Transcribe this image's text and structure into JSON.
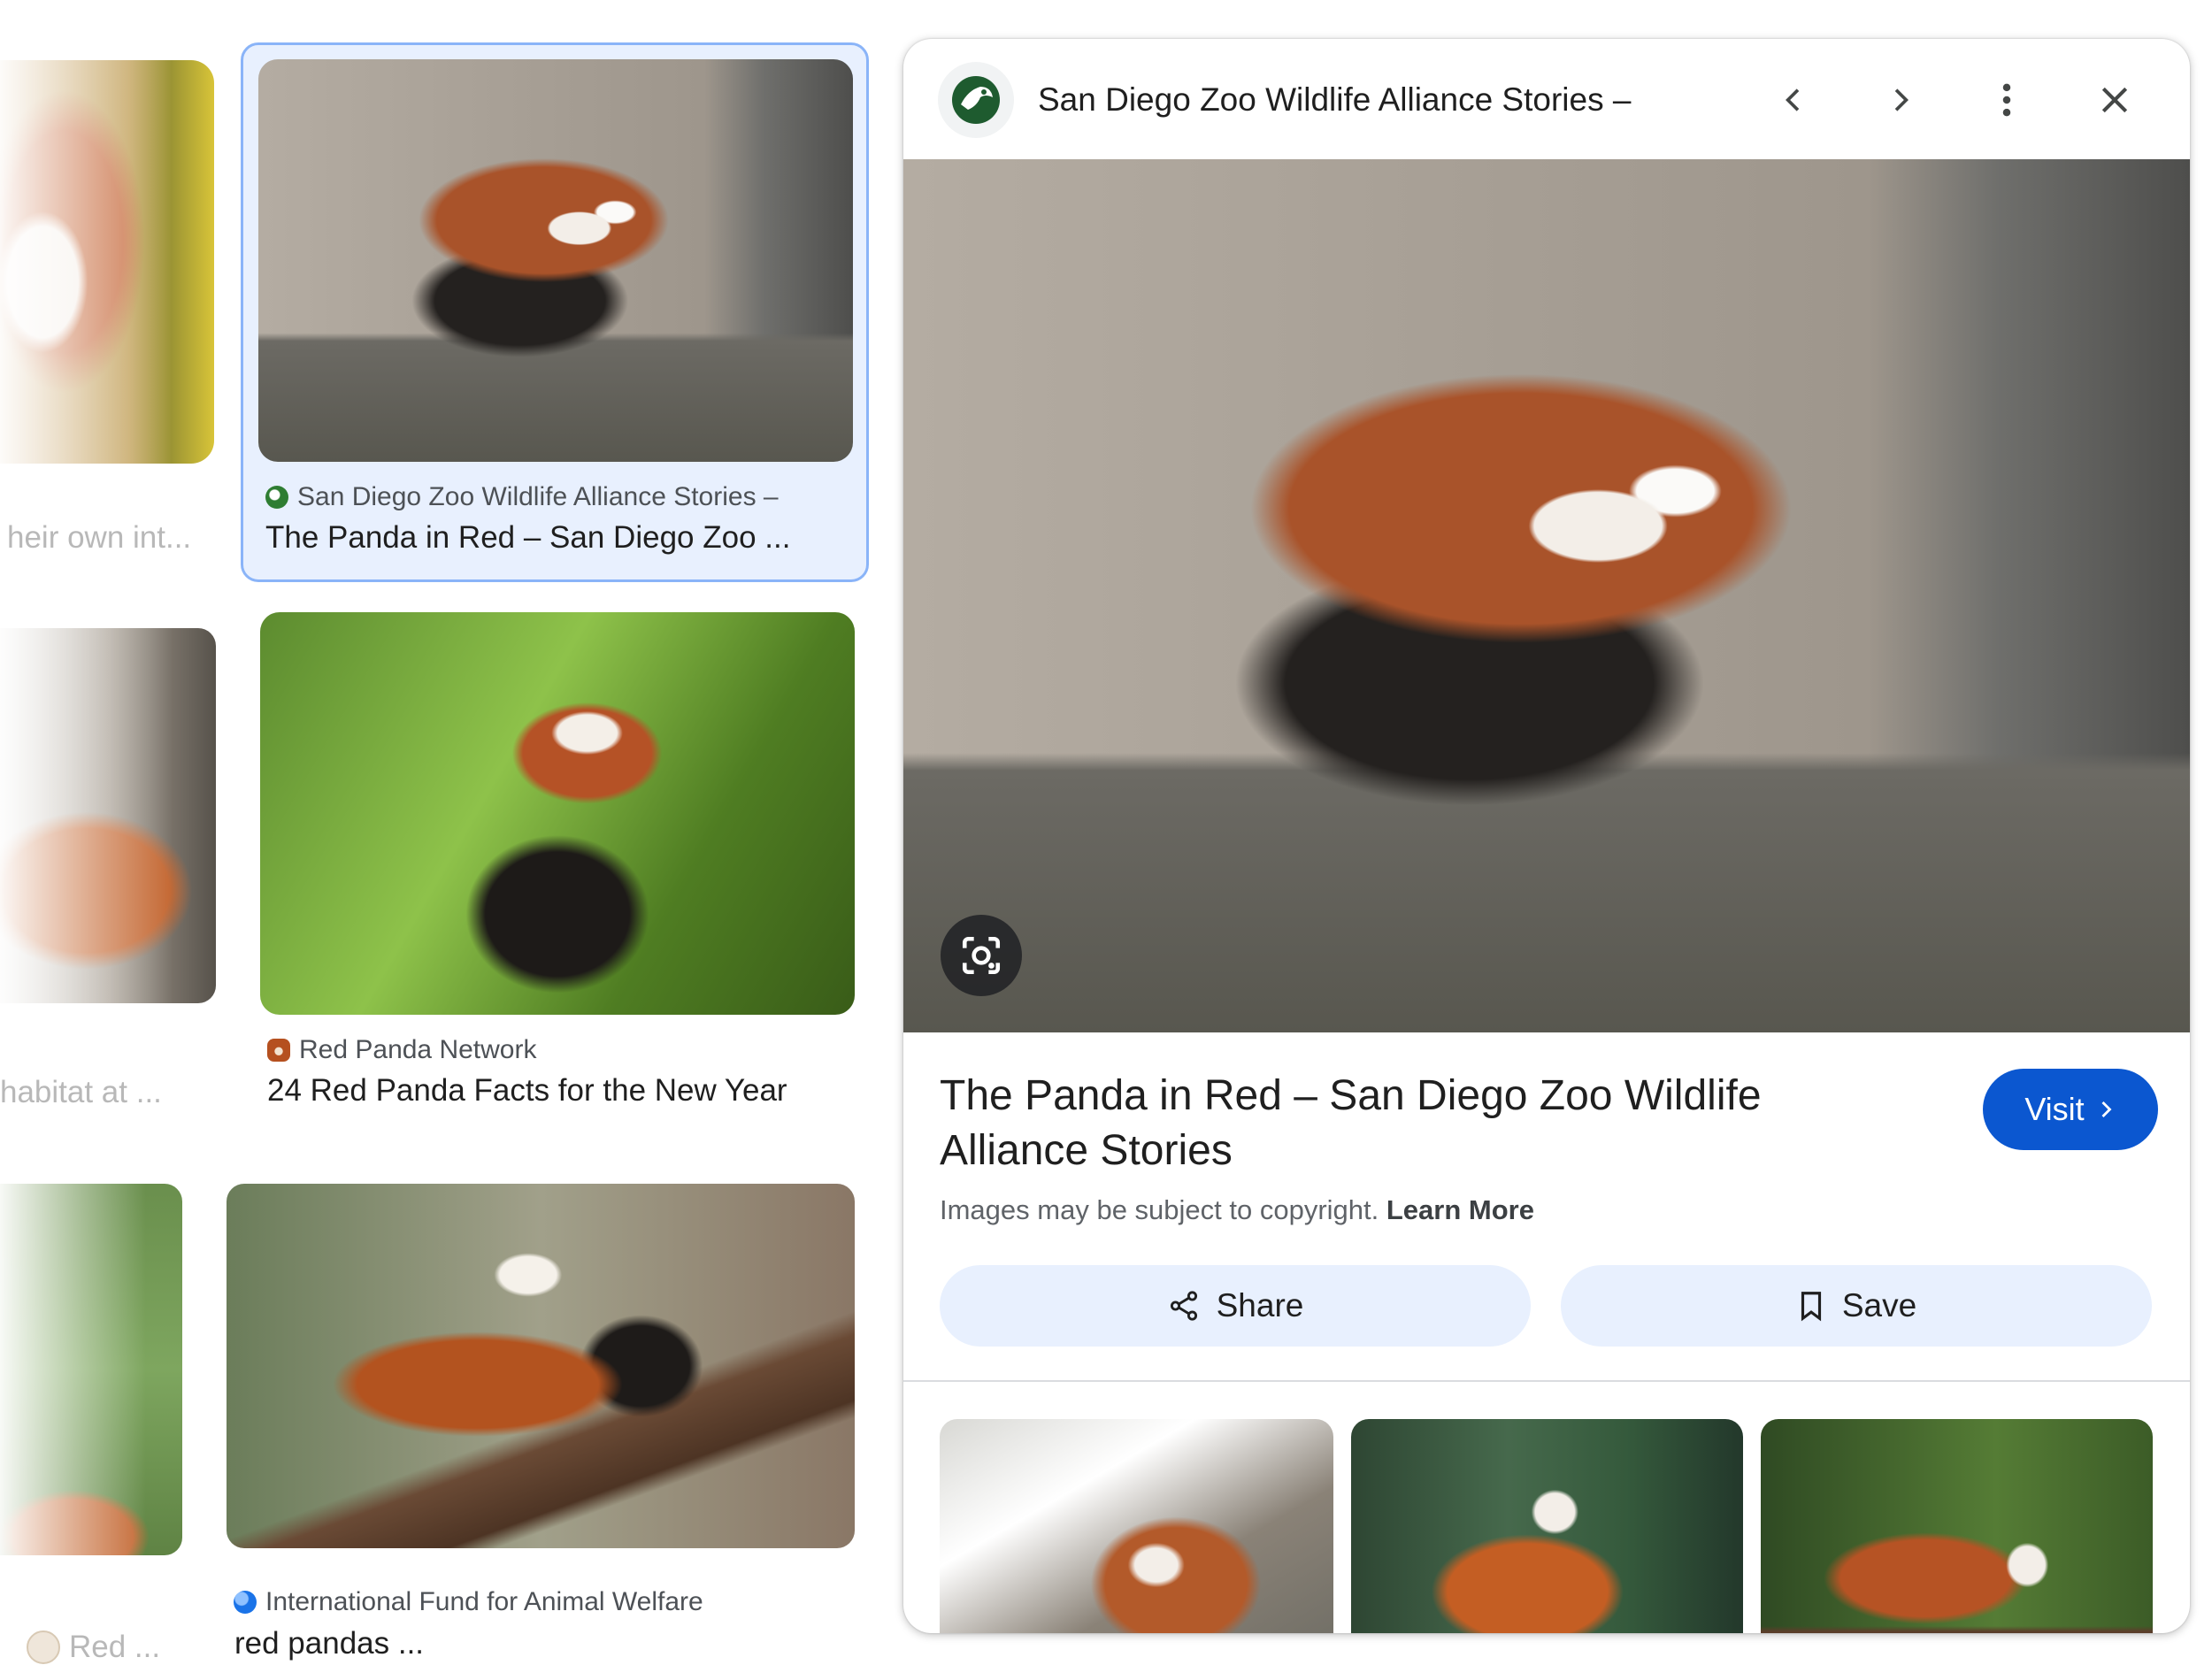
{
  "grid": {
    "col1": [
      {
        "title": "heir own int..."
      },
      {
        "title": "habitat at ..."
      },
      {
        "title": "Red ..."
      }
    ],
    "col2": [
      {
        "source": "San Diego Zoo Wildlife Alliance Stories –",
        "title": "The Panda in Red – San Diego Zoo ..."
      },
      {
        "source": "Red Panda Network",
        "title": "24 Red Panda Facts for the New Year"
      },
      {
        "source": "International Fund for Animal Welfare",
        "title": "red pandas ..."
      }
    ]
  },
  "panel": {
    "header_title": "San Diego Zoo Wildlife Alliance Stories –",
    "title": "The Panda in Red – San Diego Zoo Wildlife Alliance Stories",
    "visit_label": "Visit",
    "copyright_text": "Images may be subject to copyright.",
    "learn_more": "Learn More",
    "share_label": "Share",
    "save_label": "Save"
  },
  "colors": {
    "accent": "#0b57d0",
    "selected_bg": "#e8f0fe",
    "selected_border": "#8ab4f8",
    "pill_bg": "#e8f0fe"
  }
}
